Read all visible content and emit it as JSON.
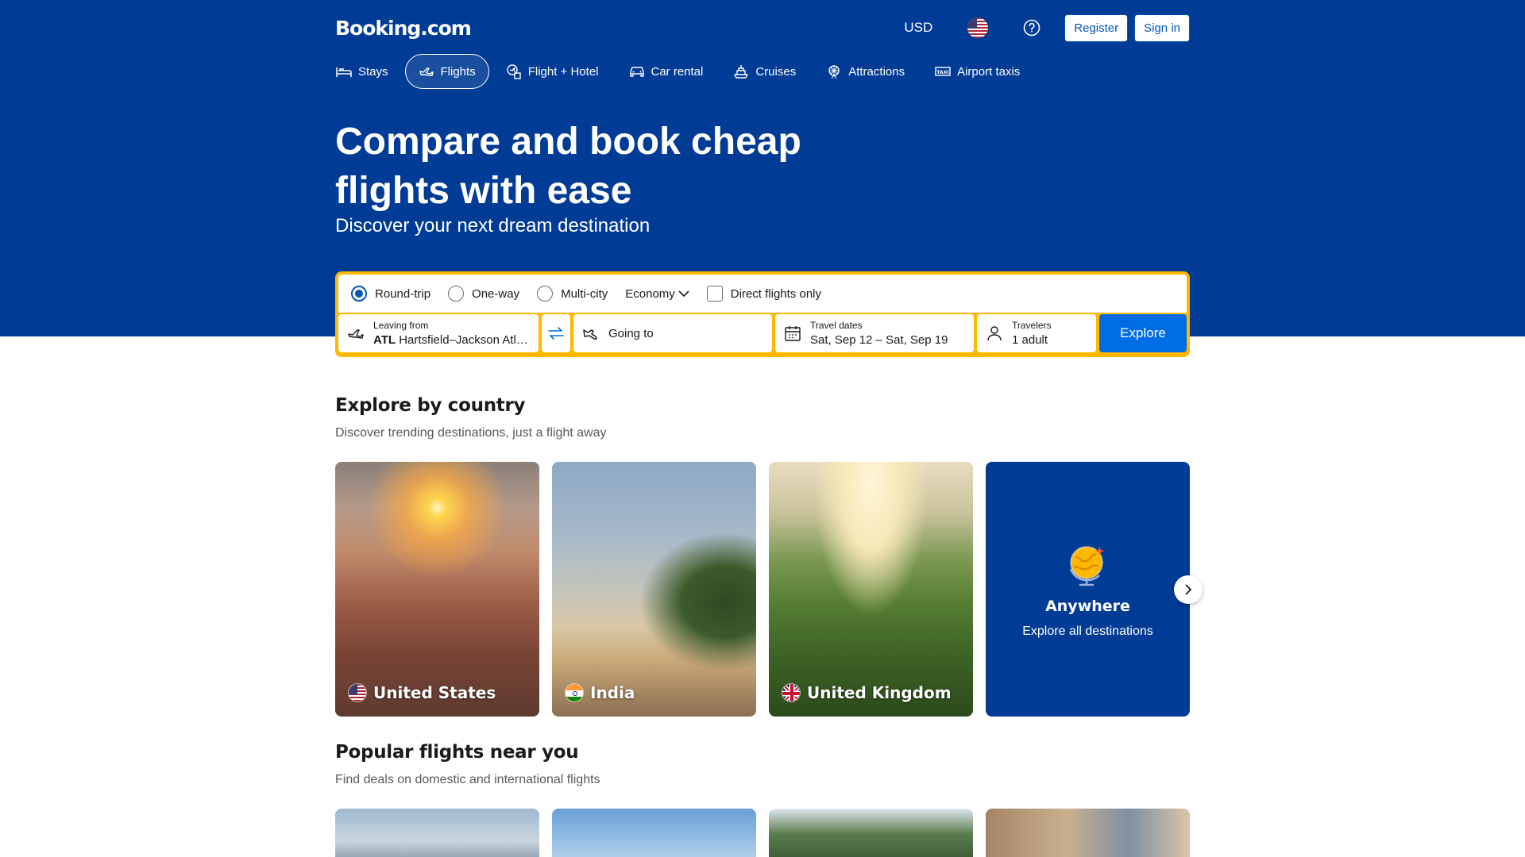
{
  "header": {
    "logo": "Booking.com",
    "currency": "USD",
    "register_label": "Register",
    "signin_label": "Sign in"
  },
  "nav": {
    "items": [
      {
        "label": "Stays",
        "icon": "bed-icon"
      },
      {
        "label": "Flights",
        "icon": "plane-icon",
        "active": true
      },
      {
        "label": "Flight + Hotel",
        "icon": "flight-hotel-icon"
      },
      {
        "label": "Car rental",
        "icon": "car-icon"
      },
      {
        "label": "Cruises",
        "icon": "ship-icon"
      },
      {
        "label": "Attractions",
        "icon": "attractions-icon"
      },
      {
        "label": "Airport taxis",
        "icon": "taxi-icon"
      }
    ]
  },
  "hero": {
    "title": "Compare and book cheap flights with ease",
    "subtitle": "Discover your next dream destination"
  },
  "search": {
    "trip_types": [
      "Round-trip",
      "One-way",
      "Multi-city"
    ],
    "selected_trip_type": "Round-trip",
    "cabin_class": "Economy",
    "direct_only_label": "Direct flights only",
    "direct_only_checked": false,
    "from_label": "Leaving from",
    "from_code": "ATL",
    "from_name": "Hartsfield–Jackson Atlant…",
    "to_placeholder": "Going to",
    "dates_label": "Travel dates",
    "dates_value": "Sat, Sep 12 – Sat, Sep 19",
    "travelers_label": "Travelers",
    "travelers_value": "1 adult",
    "explore_label": "Explore"
  },
  "explore": {
    "title": "Explore by country",
    "subtitle": "Discover trending destinations, just a flight away",
    "cards": [
      {
        "label": "United States",
        "flag": "us-flag-icon"
      },
      {
        "label": "India",
        "flag": "india-flag-icon"
      },
      {
        "label": "United Kingdom",
        "flag": "uk-flag-icon"
      }
    ],
    "anywhere_title": "Anywhere",
    "anywhere_subtitle": "Explore all destinations"
  },
  "popular": {
    "title": "Popular flights near you",
    "subtitle": "Find deals on domestic and international flights"
  },
  "colors": {
    "brand_blue": "#003b95",
    "accent_blue": "#006ce4",
    "search_border": "#ffb700"
  }
}
